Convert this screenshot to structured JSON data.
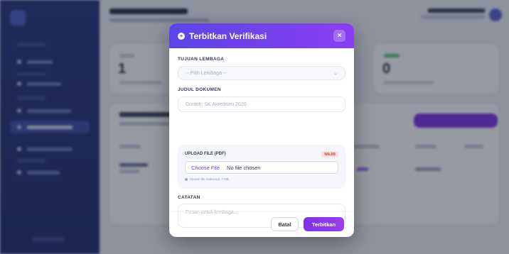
{
  "modal": {
    "title": "Terbitkan Verifikasi",
    "close_label": "×",
    "header_icon": "plus-circle-icon",
    "lembaga_label": "TUJUAN LEMBAGA",
    "lembaga_placeholder": "-- Pilih Lembaga --",
    "judul_label": "JUDUL DOKUMEN",
    "judul_placeholder": "Contoh: SK Akreditasi 2026",
    "upload_label": "UPLOAD FILE (PDF)",
    "upload_badge": "WAJIB",
    "choose_file": "Choose File",
    "no_file": "No file chosen",
    "upload_hint": "Ukuran file maksimal: 2 MB",
    "catatan_label": "CATATAN",
    "catatan_placeholder": "Pesan untuk lembaga...",
    "cancel_button": "Batal",
    "submit_button": "Terbitkan"
  },
  "background": {
    "stat_1_value": "1",
    "stat_2_value": "0"
  },
  "colors": {
    "header_start": "#5b45e8",
    "header_end": "#8a3ef0",
    "primary_button": "#7b33e6",
    "sidebar": "#23347a",
    "badge_text": "#e0363f",
    "badge_bg": "#fde0e2"
  }
}
